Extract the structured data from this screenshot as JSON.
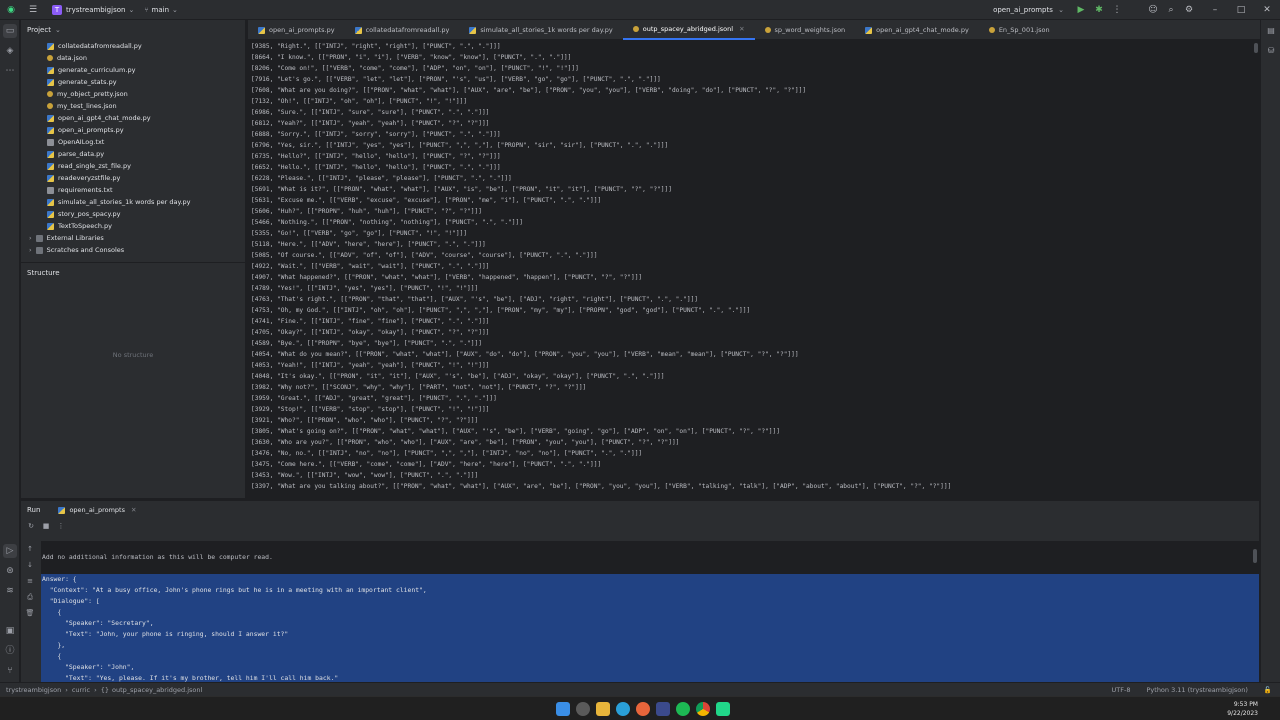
{
  "titlebar": {
    "project_badge": "T",
    "project_name": "trystreambigjson",
    "branch": "main",
    "run_config": "open_ai_prompts"
  },
  "project_panel": {
    "title": "Project",
    "items": [
      {
        "label": "collatedatafromreadall.py",
        "type": "py"
      },
      {
        "label": "data.json",
        "type": "json"
      },
      {
        "label": "generate_curriculum.py",
        "type": "py"
      },
      {
        "label": "generate_stats.py",
        "type": "py"
      },
      {
        "label": "my_object_pretty.json",
        "type": "json"
      },
      {
        "label": "my_test_lines.json",
        "type": "json"
      },
      {
        "label": "open_ai_gpt4_chat_mode.py",
        "type": "py"
      },
      {
        "label": "open_ai_prompts.py",
        "type": "py"
      },
      {
        "label": "OpenAILog.txt",
        "type": "txt"
      },
      {
        "label": "parse_data.py",
        "type": "py"
      },
      {
        "label": "read_single_zst_file.py",
        "type": "py"
      },
      {
        "label": "readeveryzstfile.py",
        "type": "py"
      },
      {
        "label": "requirements.txt",
        "type": "txt"
      },
      {
        "label": "simulate_all_stories_1k words per day.py",
        "type": "py"
      },
      {
        "label": "story_pos_spacy.py",
        "type": "py"
      },
      {
        "label": "TextToSpeech.py",
        "type": "py"
      },
      {
        "label": "External Libraries",
        "type": "folder"
      },
      {
        "label": "Scratches and Consoles",
        "type": "folder"
      }
    ]
  },
  "structure_panel": {
    "title": "Structure",
    "empty_text": "No structure"
  },
  "editor_tabs": [
    {
      "label": "open_ai_prompts.py",
      "active": false
    },
    {
      "label": "collatedatafromreadall.py",
      "active": false
    },
    {
      "label": "simulate_all_stories_1k words per day.py",
      "active": false
    },
    {
      "label": "outp_spacey_abridged.jsonl",
      "active": true
    },
    {
      "label": "sp_word_weights.json",
      "active": false
    },
    {
      "label": "open_ai_gpt4_chat_mode.py",
      "active": false
    },
    {
      "label": "En_Sp_001.json",
      "active": false
    }
  ],
  "editor_lines": [
    "[9385, \"Right.\", [[\"INTJ\", \"right\", \"right\"], [\"PUNCT\", \".\", \".\"]]]",
    "[8664, \"I know.\", [[\"PRON\", \"i\", \"i\"], [\"VERB\", \"know\", \"know\"], [\"PUNCT\", \".\", \".\"]]]",
    "[8206, \"Come on!\", [[\"VERB\", \"come\", \"come\"], [\"ADP\", \"on\", \"on\"], [\"PUNCT\", \"!\", \"!\"]]]",
    "[7916, \"Let's go.\", [[\"VERB\", \"let\", \"let\"], [\"PRON\", \"'s\", \"us\"], [\"VERB\", \"go\", \"go\"], [\"PUNCT\", \".\", \".\"]]]",
    "[7608, \"What are you doing?\", [[\"PRON\", \"what\", \"what\"], [\"AUX\", \"are\", \"be\"], [\"PRON\", \"you\", \"you\"], [\"VERB\", \"doing\", \"do\"], [\"PUNCT\", \"?\", \"?\"]]]",
    "[7132, \"Oh!\", [[\"INTJ\", \"oh\", \"oh\"], [\"PUNCT\", \"!\", \"!\"]]]",
    "[6986, \"Sure.\", [[\"INTJ\", \"sure\", \"sure\"], [\"PUNCT\", \".\", \".\"]]]",
    "[6812, \"Yeah?\", [[\"INTJ\", \"yeah\", \"yeah\"], [\"PUNCT\", \"?\", \"?\"]]]",
    "[6888, \"Sorry.\", [[\"INTJ\", \"sorry\", \"sorry\"], [\"PUNCT\", \".\", \".\"]]]",
    "[6796, \"Yes, sir.\", [[\"INTJ\", \"yes\", \"yes\"], [\"PUNCT\", \",\", \",\"], [\"PROPN\", \"sir\", \"sir\"], [\"PUNCT\", \".\", \".\"]]]",
    "[6735, \"Hello?\", [[\"INTJ\", \"hello\", \"hello\"], [\"PUNCT\", \"?\", \"?\"]]]",
    "[6652, \"Hello.\", [[\"INTJ\", \"hello\", \"hello\"], [\"PUNCT\", \".\", \".\"]]]",
    "[6228, \"Please.\", [[\"INTJ\", \"please\", \"please\"], [\"PUNCT\", \".\", \".\"]]]",
    "[5691, \"What is it?\", [[\"PRON\", \"what\", \"what\"], [\"AUX\", \"is\", \"be\"], [\"PRON\", \"it\", \"it\"], [\"PUNCT\", \"?\", \"?\"]]]",
    "[5631, \"Excuse me.\", [[\"VERB\", \"excuse\", \"excuse\"], [\"PRON\", \"me\", \"i\"], [\"PUNCT\", \".\", \".\"]]]",
    "[5606, \"Huh?\", [[\"PROPN\", \"huh\", \"huh\"], [\"PUNCT\", \"?\", \"?\"]]]",
    "[5466, \"Nothing.\", [[\"PRON\", \"nothing\", \"nothing\"], [\"PUNCT\", \".\", \".\"]]]",
    "[5355, \"Go!\", [[\"VERB\", \"go\", \"go\"], [\"PUNCT\", \"!\", \"!\"]]]",
    "[5118, \"Here.\", [[\"ADV\", \"here\", \"here\"], [\"PUNCT\", \".\", \".\"]]]",
    "[5085, \"Of course.\", [[\"ADV\", \"of\", \"of\"], [\"ADV\", \"course\", \"course\"], [\"PUNCT\", \".\", \".\"]]]",
    "[4922, \"Wait.\", [[\"VERB\", \"wait\", \"wait\"], [\"PUNCT\", \".\", \".\"]]]",
    "[4907, \"What happened?\", [[\"PRON\", \"what\", \"what\"], [\"VERB\", \"happened\", \"happen\"], [\"PUNCT\", \"?\", \"?\"]]]",
    "[4789, \"Yes!\", [[\"INTJ\", \"yes\", \"yes\"], [\"PUNCT\", \"!\", \"!\"]]]",
    "[4763, \"That's right.\", [[\"PRON\", \"that\", \"that\"], [\"AUX\", \"'s\", \"be\"], [\"ADJ\", \"right\", \"right\"], [\"PUNCT\", \".\", \".\"]]]",
    "[4753, \"Oh, my God.\", [[\"INTJ\", \"oh\", \"oh\"], [\"PUNCT\", \",\", \",\"], [\"PRON\", \"my\", \"my\"], [\"PROPN\", \"god\", \"god\"], [\"PUNCT\", \".\", \".\"]]]",
    "[4741, \"Fine.\", [[\"INTJ\", \"fine\", \"fine\"], [\"PUNCT\", \".\", \".\"]]]",
    "[4705, \"Okay?\", [[\"INTJ\", \"okay\", \"okay\"], [\"PUNCT\", \"?\", \"?\"]]]",
    "[4589, \"Bye.\", [[\"PROPN\", \"bye\", \"bye\"], [\"PUNCT\", \".\", \".\"]]]",
    "[4054, \"What do you mean?\", [[\"PRON\", \"what\", \"what\"], [\"AUX\", \"do\", \"do\"], [\"PRON\", \"you\", \"you\"], [\"VERB\", \"mean\", \"mean\"], [\"PUNCT\", \"?\", \"?\"]]]",
    "[4053, \"Yeah!\", [[\"INTJ\", \"yeah\", \"yeah\"], [\"PUNCT\", \"!\", \"!\"]]]",
    "[4048, \"It's okay.\", [[\"PRON\", \"it\", \"it\"], [\"AUX\", \"'s\", \"be\"], [\"ADJ\", \"okay\", \"okay\"], [\"PUNCT\", \".\", \".\"]]]",
    "[3982, \"Why not?\", [[\"SCONJ\", \"why\", \"why\"], [\"PART\", \"not\", \"not\"], [\"PUNCT\", \"?\", \"?\"]]]",
    "[3959, \"Great.\", [[\"ADJ\", \"great\", \"great\"], [\"PUNCT\", \".\", \".\"]]]",
    "[3929, \"Stop!\", [[\"VERB\", \"stop\", \"stop\"], [\"PUNCT\", \"!\", \"!\"]]]",
    "[3921, \"Who?\", [[\"PRON\", \"who\", \"who\"], [\"PUNCT\", \"?\", \"?\"]]]",
    "[3805, \"What's going on?\", [[\"PRON\", \"what\", \"what\"], [\"AUX\", \"'s\", \"be\"], [\"VERB\", \"going\", \"go\"], [\"ADP\", \"on\", \"on\"], [\"PUNCT\", \"?\", \"?\"]]]",
    "[3630, \"Who are you?\", [[\"PRON\", \"who\", \"who\"], [\"AUX\", \"are\", \"be\"], [\"PRON\", \"you\", \"you\"], [\"PUNCT\", \"?\", \"?\"]]]",
    "[3476, \"No, no.\", [[\"INTJ\", \"no\", \"no\"], [\"PUNCT\", \",\", \",\"], [\"INTJ\", \"no\", \"no\"], [\"PUNCT\", \".\", \".\"]]]",
    "[3475, \"Come here.\", [[\"VERB\", \"come\", \"come\"], [\"ADV\", \"here\", \"here\"], [\"PUNCT\", \".\", \".\"]]]",
    "[3453, \"Wow.\", [[\"INTJ\", \"wow\", \"wow\"], [\"PUNCT\", \".\", \".\"]]]",
    "[3397, \"What are you talking about?\", [[\"PRON\", \"what\", \"what\"], [\"AUX\", \"are\", \"be\"], [\"PRON\", \"you\", \"you\"], [\"VERB\", \"talking\", \"talk\"], [\"ADP\", \"about\", \"about\"], [\"PUNCT\", \"?\", \"?\"]]]"
  ],
  "run_panel": {
    "title": "Run",
    "tab_label": "open_ai_prompts",
    "console_lines": [
      {
        "text": "",
        "selected": false
      },
      {
        "text": "Add no additional information as this will be computer read.",
        "selected": false
      },
      {
        "text": "",
        "selected": false
      },
      {
        "text": "Answer: {",
        "selected": true
      },
      {
        "text": "  \"Context\": \"At a busy office, John's phone rings but he is in a meeting with an important client\",",
        "selected": true
      },
      {
        "text": "  \"Dialogue\": [",
        "selected": true
      },
      {
        "text": "    {",
        "selected": true
      },
      {
        "text": "      \"Speaker\": \"Secretary\",",
        "selected": true
      },
      {
        "text": "      \"Text\": \"John, your phone is ringing, should I answer it?\"",
        "selected": true
      },
      {
        "text": "    },",
        "selected": true
      },
      {
        "text": "    {",
        "selected": true
      },
      {
        "text": "      \"Speaker\": \"John\",",
        "selected": true
      },
      {
        "text": "      \"Text\": \"Yes, please. If it's my brother, tell him I'll call him back.\"",
        "selected": true
      }
    ]
  },
  "statusbar": {
    "breadcrumb": [
      "trystreambigjson",
      "curric",
      "outp_spacey_abridged.jsonl"
    ],
    "encoding": "UTF-8",
    "interpreter": "Python 3.11 (trystreambigjson)"
  },
  "taskbar": {
    "time": "9:53 PM",
    "date": "9/22/2023"
  }
}
